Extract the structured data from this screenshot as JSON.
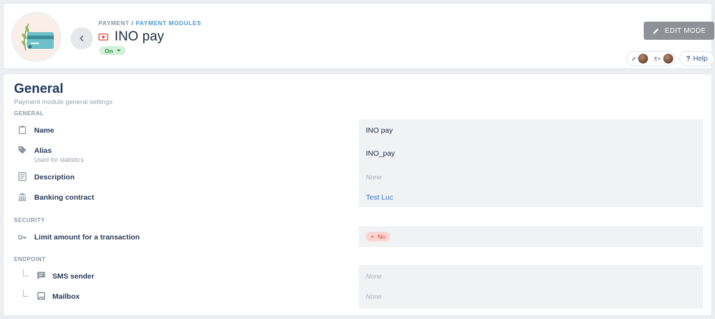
{
  "header": {
    "breadcrumb": {
      "parent": "PAYMENT",
      "separator": "/",
      "current": "PAYMENT MODULES"
    },
    "title": "INO pay",
    "status": "On",
    "edit_button": "EDIT MODE",
    "help_button": "Help"
  },
  "section": {
    "title": "General",
    "subtitle": "Payment module general settings"
  },
  "groups": {
    "general": "GENERAL",
    "security": "SECURITY",
    "endpoint": "ENDPOINT"
  },
  "fields": {
    "name": {
      "label": "Name",
      "value": "INO pay",
      "icon": "clipboard-icon"
    },
    "alias": {
      "label": "Alias",
      "sublabel": "Used for statistics",
      "value": "INO_pay",
      "icon": "tag-icon"
    },
    "description": {
      "label": "Description",
      "value": "None",
      "icon": "document-icon"
    },
    "banking_contract": {
      "label": "Banking contract",
      "value": "Test Luc",
      "icon": "bank-icon"
    },
    "limit_amount": {
      "label": "Limit amount for a transaction",
      "value": "No",
      "icon": "key-icon"
    },
    "sms_sender": {
      "label": "SMS sender",
      "value": "None",
      "icon": "message-icon"
    },
    "mailbox": {
      "label": "Mailbox",
      "value": "None",
      "icon": "inbox-icon"
    }
  },
  "colors": {
    "status_on_bg": "#d5f1dc",
    "status_on_text": "#2d8c4a",
    "no_badge_bg": "#fbd5d2",
    "no_badge_text": "#d9443b",
    "link": "#3a74c4",
    "edit_button_bg": "#8e9196"
  }
}
